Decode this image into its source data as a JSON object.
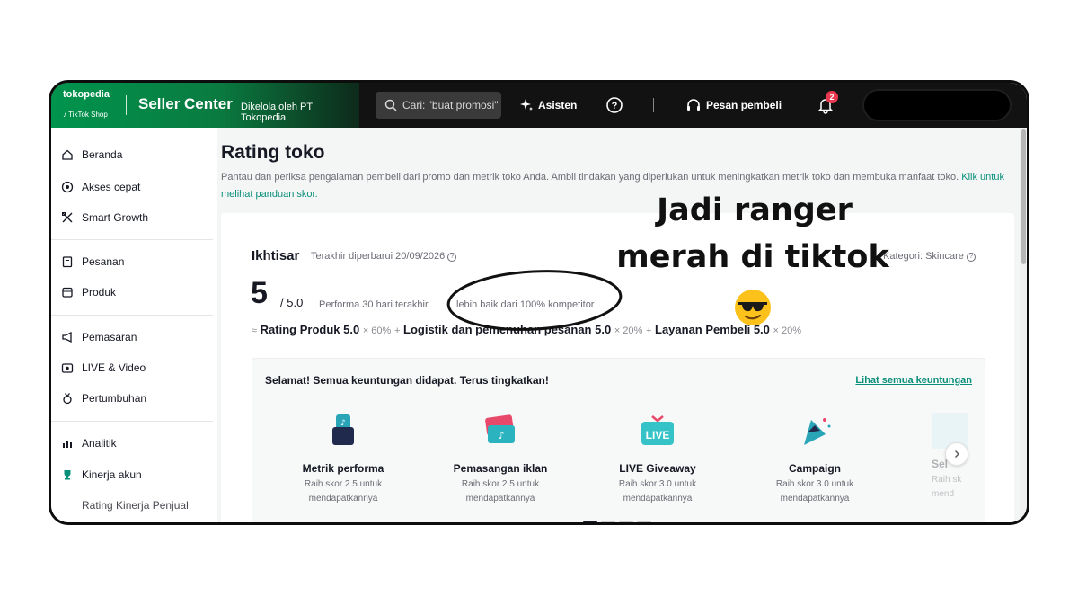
{
  "topbar": {
    "brand_line1": "tokopedia",
    "brand_line2": "TikTok Shop",
    "title": "Seller Center",
    "subtitle": "Dikelola oleh PT Tokopedia",
    "search_placeholder": "Cari: \"buat promosi\"",
    "asisten_label": "Asisten",
    "pesan_label": "Pesan pembeli",
    "notification_count": "2",
    "brand_color": "#00944d"
  },
  "sidebar": {
    "items": [
      {
        "label": "Beranda",
        "icon": "home-icon"
      },
      {
        "label": "Akses cepat",
        "icon": "quick-access-icon"
      },
      {
        "label": "Smart Growth",
        "icon": "growth-icon"
      },
      {
        "label": "Pesanan",
        "icon": "orders-icon"
      },
      {
        "label": "Produk",
        "icon": "product-icon"
      },
      {
        "label": "Pemasaran",
        "icon": "megaphone-icon"
      },
      {
        "label": "LIVE & Video",
        "icon": "live-icon"
      },
      {
        "label": "Pertumbuhan",
        "icon": "medal-icon"
      },
      {
        "label": "Analitik",
        "icon": "analytics-icon"
      },
      {
        "label": "Kinerja akun",
        "icon": "trophy-icon"
      },
      {
        "label": "Rating Kinerja Penjual",
        "icon": ""
      }
    ]
  },
  "main": {
    "title": "Rating toko",
    "description": "Pantau dan periksa pengalaman pembeli dari promo dan metrik toko Anda. Ambil tindakan yang diperlukan untuk meningkatkan metrik toko dan membuka manfaat toko.",
    "guide_link": "Klik untuk melihat panduan skor.",
    "summary": {
      "title": "Ikhtisar",
      "updated": "Terakhir diperbarui 20/09/2026",
      "category": "Kategori: Skincare",
      "score": "5",
      "score_max": "/ 5.0",
      "period": "Performa 30 hari terakhir",
      "comparison": "lebih baik dari 100% kompetitor",
      "formula": [
        {
          "label": "Rating Produk 5.0",
          "weight": "× 60%"
        },
        {
          "label": "Logistik dan pemenuhan pesanan 5.0",
          "weight": "× 20%"
        },
        {
          "label": "Layanan Pembeli 5.0",
          "weight": "× 20%"
        }
      ]
    },
    "benefits": {
      "title": "Selamat! Semua keuntungan didapat. Terus tingkatkan!",
      "link": "Lihat semua keuntungan",
      "items": [
        {
          "label": "Metrik performa",
          "desc1": "Raih skor 2.5 untuk",
          "desc2": "mendapatkannya"
        },
        {
          "label": "Pemasangan iklan",
          "desc1": "Raih skor 2.5 untuk",
          "desc2": "mendapatkannya"
        },
        {
          "label": "LIVE Giveaway",
          "desc1": "Raih skor 3.0 untuk",
          "desc2": "mendapatkannya"
        },
        {
          "label": "Campaign",
          "desc1": "Raih skor 3.0 untuk",
          "desc2": "mendapatkannya"
        },
        {
          "label": "Sel",
          "desc1": "Raih sk",
          "desc2": "mend"
        }
      ],
      "live_icon_text": "LIVE"
    }
  },
  "overlay": {
    "line1": "Jadi ranger",
    "line2": "merah di tiktok"
  }
}
